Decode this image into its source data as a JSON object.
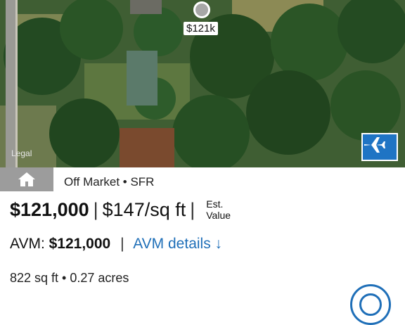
{
  "map": {
    "pin_label": "$121k",
    "legal_label": "Legal",
    "satellite_button_icon": "airplane-icon"
  },
  "listing": {
    "home_tab_icon": "house-icon",
    "status": "Off Market • SFR",
    "price": "$121,000",
    "separator": "|",
    "price_per_sqft": "$147/sq ft",
    "est_value_label": "Est.\nValue",
    "avm_label": "AVM: ",
    "avm_value": "$121,000",
    "avm_details_link": "AVM details ↓",
    "facts": "822 sq ft • 0.27 acres",
    "fab_icon": "dollar-icon"
  },
  "colors": {
    "accent": "#1f6fb8",
    "satellite_button": "#1f74c4",
    "home_tab": "#9c9c9c"
  }
}
